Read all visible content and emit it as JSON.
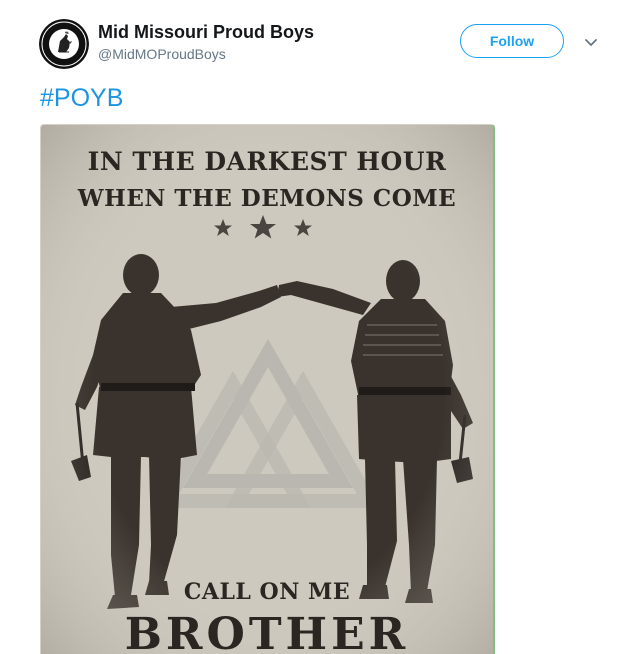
{
  "user": {
    "display_name": "Mid Missouri Proud Boys",
    "handle": "@MidMOProudBoys",
    "avatar_icon": "rooster-emblem-icon"
  },
  "actions": {
    "follow_label": "Follow",
    "menu_icon": "chevron-down-icon"
  },
  "tweet": {
    "hashtag": "#POYB"
  },
  "poster": {
    "line1": "IN THE DARKEST HOUR",
    "line2": "WHEN THE DEMONS COME",
    "line3": "CALL ON ME",
    "line4": "BROTHER"
  },
  "colors": {
    "accent": "#1da1f2",
    "hashtag": "#1b95e0",
    "name": "#14171a",
    "handle": "#657786",
    "poster_bg": "#cdc9bf",
    "poster_ink": "#2b2622"
  }
}
